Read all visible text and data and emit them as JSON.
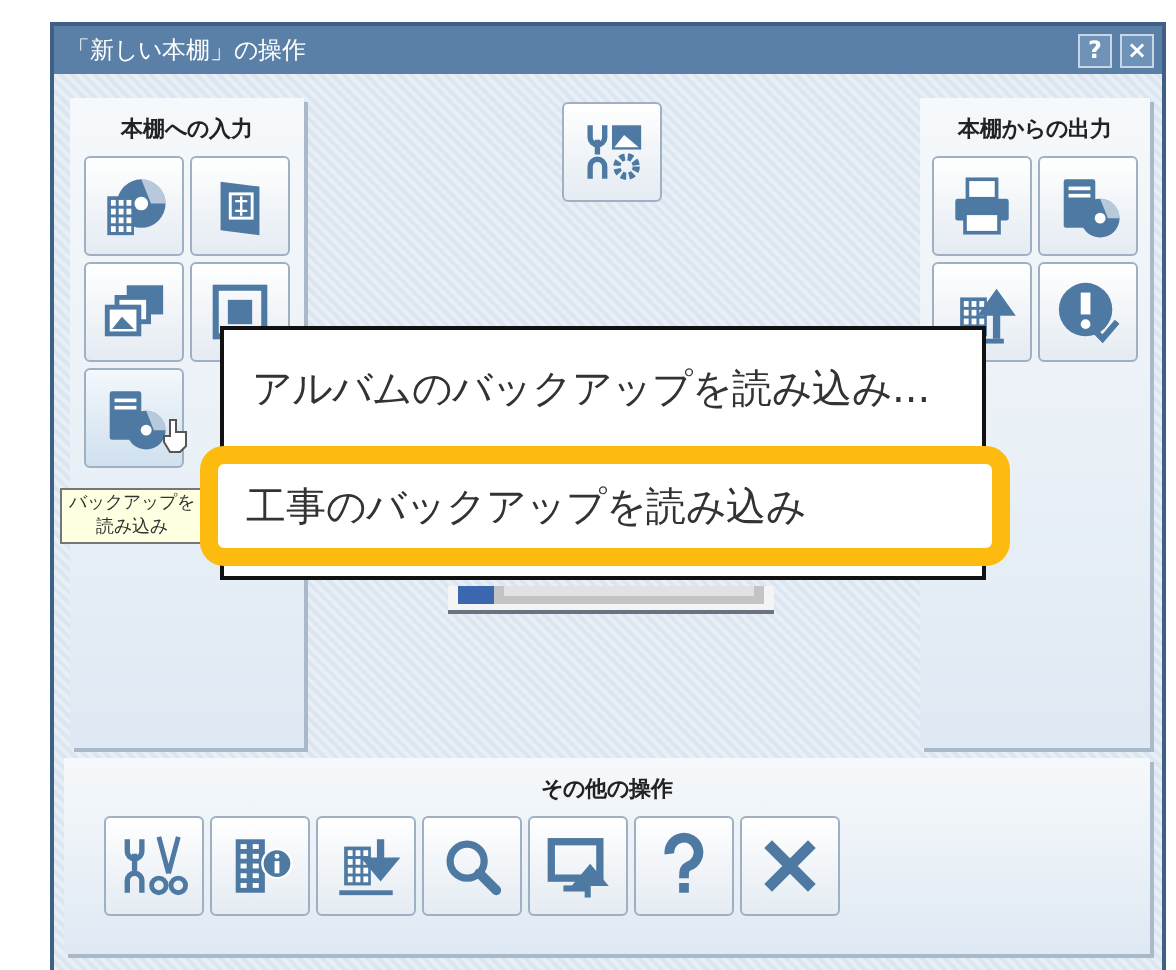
{
  "window": {
    "title": "「新しい本棚」の操作",
    "controls": [
      "?",
      "×"
    ]
  },
  "input_panel": {
    "title": "本棚への入力",
    "buttons": [
      {
        "kind": "numbers-disc",
        "hovered": false
      },
      {
        "kind": "book",
        "hovered": false
      },
      {
        "kind": "photos",
        "hovered": false
      },
      {
        "kind": "frame",
        "hovered": false
      },
      {
        "kind": "server-disc",
        "hovered": true
      }
    ]
  },
  "center_button": {
    "kind": "tools-picture"
  },
  "output_panel": {
    "title": "本棚からの出力",
    "buttons": [
      {
        "kind": "printer"
      },
      {
        "kind": "server-disc"
      },
      {
        "kind": "numbers-up"
      },
      {
        "kind": "alert-check"
      }
    ]
  },
  "tooltip": {
    "text": "バックアップを読み込み"
  },
  "menu": {
    "items": [
      {
        "label": "アルバムのバックアップを読み込み...",
        "selected": false
      },
      {
        "label": "工事のバックアップを読み込み",
        "selected": true
      }
    ]
  },
  "other_panel": {
    "title": "その他の操作",
    "buttons": [
      {
        "kind": "tools-scissors"
      },
      {
        "kind": "building-info"
      },
      {
        "kind": "numbers-down"
      },
      {
        "kind": "search"
      },
      {
        "kind": "monitor-up"
      },
      {
        "kind": "help"
      },
      {
        "kind": "close"
      }
    ]
  }
}
